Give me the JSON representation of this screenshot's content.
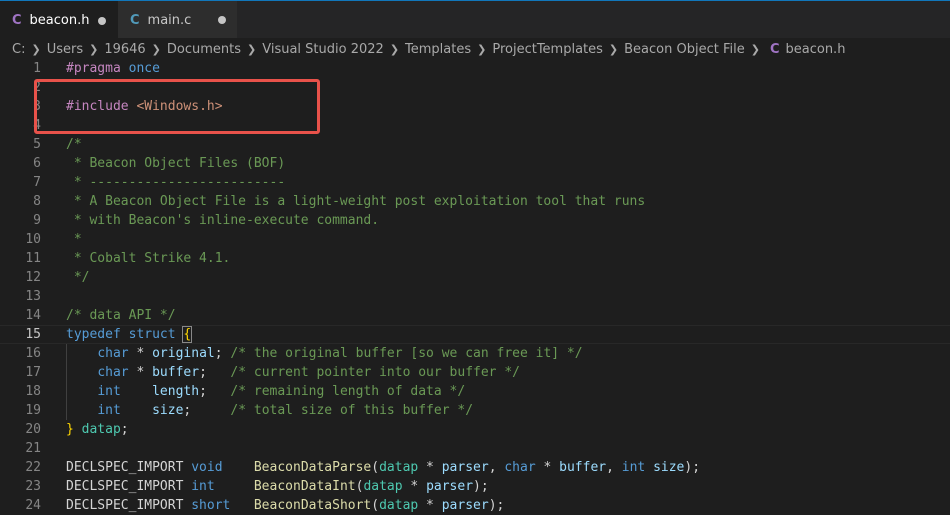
{
  "tabs": [
    {
      "icon": "C",
      "label": "beacon.h",
      "active": true,
      "dirty": true
    },
    {
      "icon": "C",
      "label": "main.c",
      "active": false,
      "dirty": true
    }
  ],
  "breadcrumb": {
    "items": [
      "C:",
      "Users",
      "19646",
      "Documents",
      "Visual Studio 2022",
      "Templates",
      "ProjectTemplates",
      "Beacon Object File"
    ],
    "file_icon": "C",
    "file": "beacon.h"
  },
  "editor": {
    "current_line": 15,
    "lines": [
      {
        "n": "1",
        "tokens": [
          [
            "pp",
            "#pragma"
          ],
          [
            "tx",
            " "
          ],
          [
            "kw",
            "once"
          ]
        ]
      },
      {
        "n": "2",
        "tokens": []
      },
      {
        "n": "3",
        "tokens": [
          [
            "pp",
            "#include"
          ],
          [
            "tx",
            " "
          ],
          [
            "str",
            "<Windows.h>"
          ]
        ]
      },
      {
        "n": "4",
        "tokens": []
      },
      {
        "n": "5",
        "tokens": [
          [
            "cm",
            "/*"
          ]
        ]
      },
      {
        "n": "6",
        "tokens": [
          [
            "cm",
            " * Beacon Object Files (BOF)"
          ]
        ]
      },
      {
        "n": "7",
        "tokens": [
          [
            "cm",
            " * -------------------------"
          ]
        ]
      },
      {
        "n": "8",
        "tokens": [
          [
            "cm",
            " * A Beacon Object File is a light-weight post exploitation tool that runs"
          ]
        ]
      },
      {
        "n": "9",
        "tokens": [
          [
            "cm",
            " * with Beacon's inline-execute command."
          ]
        ]
      },
      {
        "n": "10",
        "tokens": [
          [
            "cm",
            " *"
          ]
        ]
      },
      {
        "n": "11",
        "tokens": [
          [
            "cm",
            " * Cobalt Strike 4.1."
          ]
        ]
      },
      {
        "n": "12",
        "tokens": [
          [
            "cm",
            " */"
          ]
        ]
      },
      {
        "n": "13",
        "tokens": []
      },
      {
        "n": "14",
        "tokens": [
          [
            "cm",
            "/* data API */"
          ]
        ]
      },
      {
        "n": "15",
        "tokens": [
          [
            "kw",
            "typedef"
          ],
          [
            "tx",
            " "
          ],
          [
            "kw",
            "struct"
          ],
          [
            "tx",
            " "
          ],
          [
            "br",
            "{"
          ]
        ]
      },
      {
        "n": "16",
        "tokens": [
          [
            "tx",
            "    "
          ],
          [
            "kw",
            "char"
          ],
          [
            "tx",
            " * "
          ],
          [
            "id",
            "original"
          ],
          [
            "tx",
            "; "
          ],
          [
            "cm",
            "/* the original buffer [so we can free it] */"
          ]
        ]
      },
      {
        "n": "17",
        "tokens": [
          [
            "tx",
            "    "
          ],
          [
            "kw",
            "char"
          ],
          [
            "tx",
            " * "
          ],
          [
            "id",
            "buffer"
          ],
          [
            "tx",
            ";   "
          ],
          [
            "cm",
            "/* current pointer into our buffer */"
          ]
        ]
      },
      {
        "n": "18",
        "tokens": [
          [
            "tx",
            "    "
          ],
          [
            "kw",
            "int"
          ],
          [
            "tx",
            "    "
          ],
          [
            "id",
            "length"
          ],
          [
            "tx",
            ";   "
          ],
          [
            "cm",
            "/* remaining length of data */"
          ]
        ]
      },
      {
        "n": "19",
        "tokens": [
          [
            "tx",
            "    "
          ],
          [
            "kw",
            "int"
          ],
          [
            "tx",
            "    "
          ],
          [
            "id",
            "size"
          ],
          [
            "tx",
            ";     "
          ],
          [
            "cm",
            "/* total size of this buffer */"
          ]
        ]
      },
      {
        "n": "20",
        "tokens": [
          [
            "br",
            "}"
          ],
          [
            "tx",
            " "
          ],
          [
            "ty",
            "datap"
          ],
          [
            "tx",
            ";"
          ]
        ]
      },
      {
        "n": "21",
        "tokens": []
      },
      {
        "n": "22",
        "tokens": [
          [
            "tx",
            "DECLSPEC_IMPORT "
          ],
          [
            "kw",
            "void"
          ],
          [
            "tx",
            "    "
          ],
          [
            "fn",
            "BeaconDataParse"
          ],
          [
            "tx",
            "("
          ],
          [
            "ty",
            "datap"
          ],
          [
            "tx",
            " * "
          ],
          [
            "id",
            "parser"
          ],
          [
            "tx",
            ", "
          ],
          [
            "kw",
            "char"
          ],
          [
            "tx",
            " * "
          ],
          [
            "id",
            "buffer"
          ],
          [
            "tx",
            ", "
          ],
          [
            "kw",
            "int"
          ],
          [
            "tx",
            " "
          ],
          [
            "id",
            "size"
          ],
          [
            "tx",
            ");"
          ]
        ]
      },
      {
        "n": "23",
        "tokens": [
          [
            "tx",
            "DECLSPEC_IMPORT "
          ],
          [
            "kw",
            "int"
          ],
          [
            "tx",
            "     "
          ],
          [
            "fn",
            "BeaconDataInt"
          ],
          [
            "tx",
            "("
          ],
          [
            "ty",
            "datap"
          ],
          [
            "tx",
            " * "
          ],
          [
            "id",
            "parser"
          ],
          [
            "tx",
            ");"
          ]
        ]
      },
      {
        "n": "24",
        "tokens": [
          [
            "tx",
            "DECLSPEC_IMPORT "
          ],
          [
            "kw",
            "short"
          ],
          [
            "tx",
            "   "
          ],
          [
            "fn",
            "BeaconDataShort"
          ],
          [
            "tx",
            "("
          ],
          [
            "ty",
            "datap"
          ],
          [
            "tx",
            " * "
          ],
          [
            "id",
            "parser"
          ],
          [
            "tx",
            ");"
          ]
        ]
      }
    ]
  },
  "colors": {
    "background": "#1e1e1e",
    "highlight_box": "#e8524a",
    "c_file_icon": "#a074c4",
    "main_c_icon": "#519aba"
  }
}
